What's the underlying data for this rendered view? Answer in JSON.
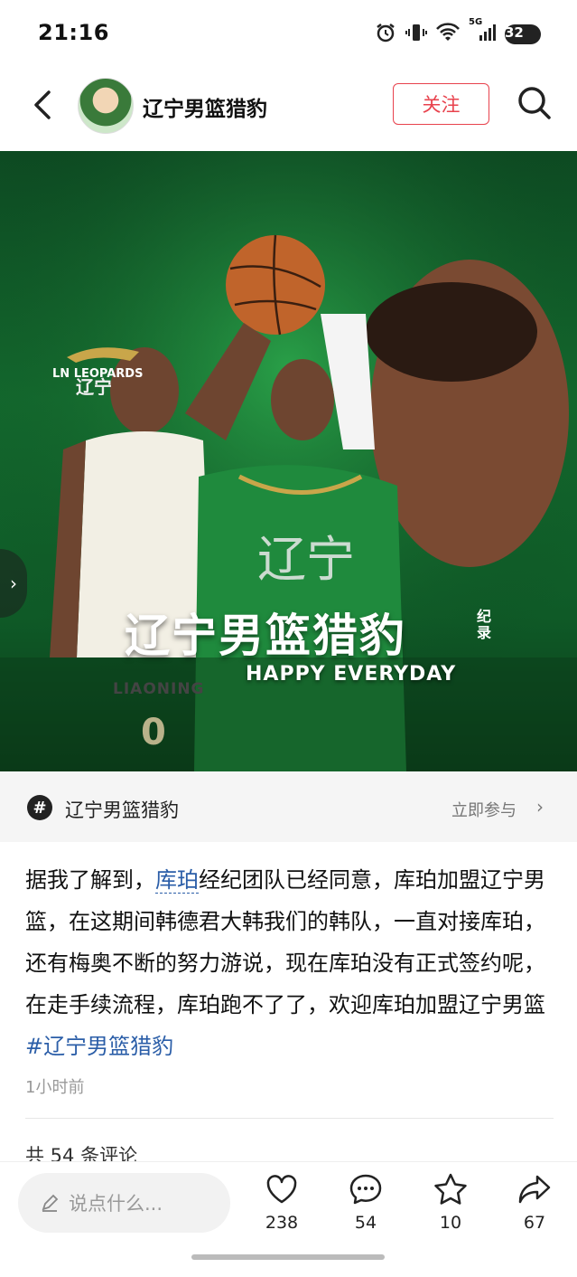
{
  "status_bar": {
    "time": "21:16",
    "network": "5G",
    "battery": "32"
  },
  "header": {
    "account_name": "辽宁男篮猎豹",
    "follow_label": "关注"
  },
  "hero": {
    "logo_text": "LN LEOPARDS",
    "logo_sub": "辽宁",
    "title": "辽宁男篮猎豹",
    "side_text": "纪录",
    "subtitle": "HAPPY EVERYDAY",
    "jersey_text": "LIAONING",
    "jersey_number": "0"
  },
  "topic": {
    "name": "辽宁男篮猎豹",
    "action_label": "立即参与"
  },
  "post": {
    "text_before": "据我了解到，",
    "link_text": "库珀",
    "text_after": "经纪团队已经同意，库珀加盟辽宁男篮，在这期间韩德君大韩我们的韩队，一直对接库珀，还有梅奥不断的努力游说，现在库珀没有正式签约呢，在走手续流程，库珀跑不了了，欢迎库珀加盟辽宁男篮",
    "hashtag": "#辽宁男篮猎豹",
    "time_ago": "1小时前"
  },
  "comments_header": "共 54 条评论",
  "bottom_bar": {
    "input_placeholder": "说点什么...",
    "likes": "238",
    "comments": "54",
    "favorites": "10",
    "shares": "67"
  }
}
